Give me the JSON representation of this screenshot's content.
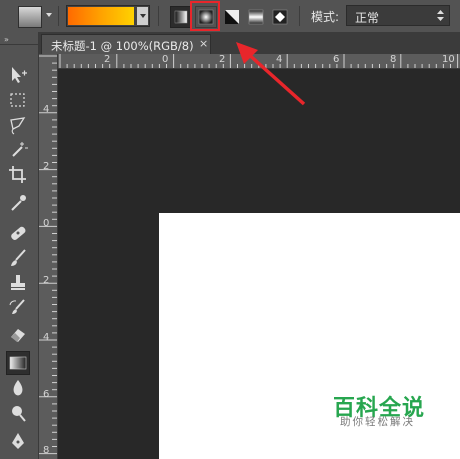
{
  "options_bar": {
    "gradient_preset": {
      "colors": [
        "#ff6a00",
        "#ffa200",
        "#ffd200"
      ]
    },
    "gradient_types": [
      {
        "name": "linear-gradient",
        "active": true
      },
      {
        "name": "radial-gradient",
        "active": false,
        "highlighted": true
      },
      {
        "name": "angle-gradient",
        "active": false
      },
      {
        "name": "reflected-gradient",
        "active": false
      },
      {
        "name": "diamond-gradient",
        "active": false
      }
    ],
    "mode_label": "模式:",
    "mode_value": "正常"
  },
  "toolbox": {
    "collapse_glyph": "»",
    "tools": [
      "move",
      "marquee",
      "lasso",
      "magic-wand",
      "crop",
      "eyedropper",
      "healing-brush",
      "brush",
      "clone-stamp",
      "history-brush",
      "eraser",
      "gradient",
      "blur",
      "dodge",
      "pen"
    ],
    "selected_tool": "gradient"
  },
  "document": {
    "tab_title": "未标题-1 @ 100%(RGB/8)",
    "close_glyph": "×"
  },
  "rulers": {
    "horizontal": [
      "2",
      "0",
      "2",
      "4",
      "6",
      "8",
      "10",
      "12"
    ],
    "vertical": [
      "4",
      "2",
      "0",
      "2",
      "4",
      "6",
      "8"
    ]
  },
  "watermark": {
    "title": "百科全说",
    "subtitle": "助你轻松解决"
  },
  "annotation": {
    "color": "#e8262b"
  }
}
